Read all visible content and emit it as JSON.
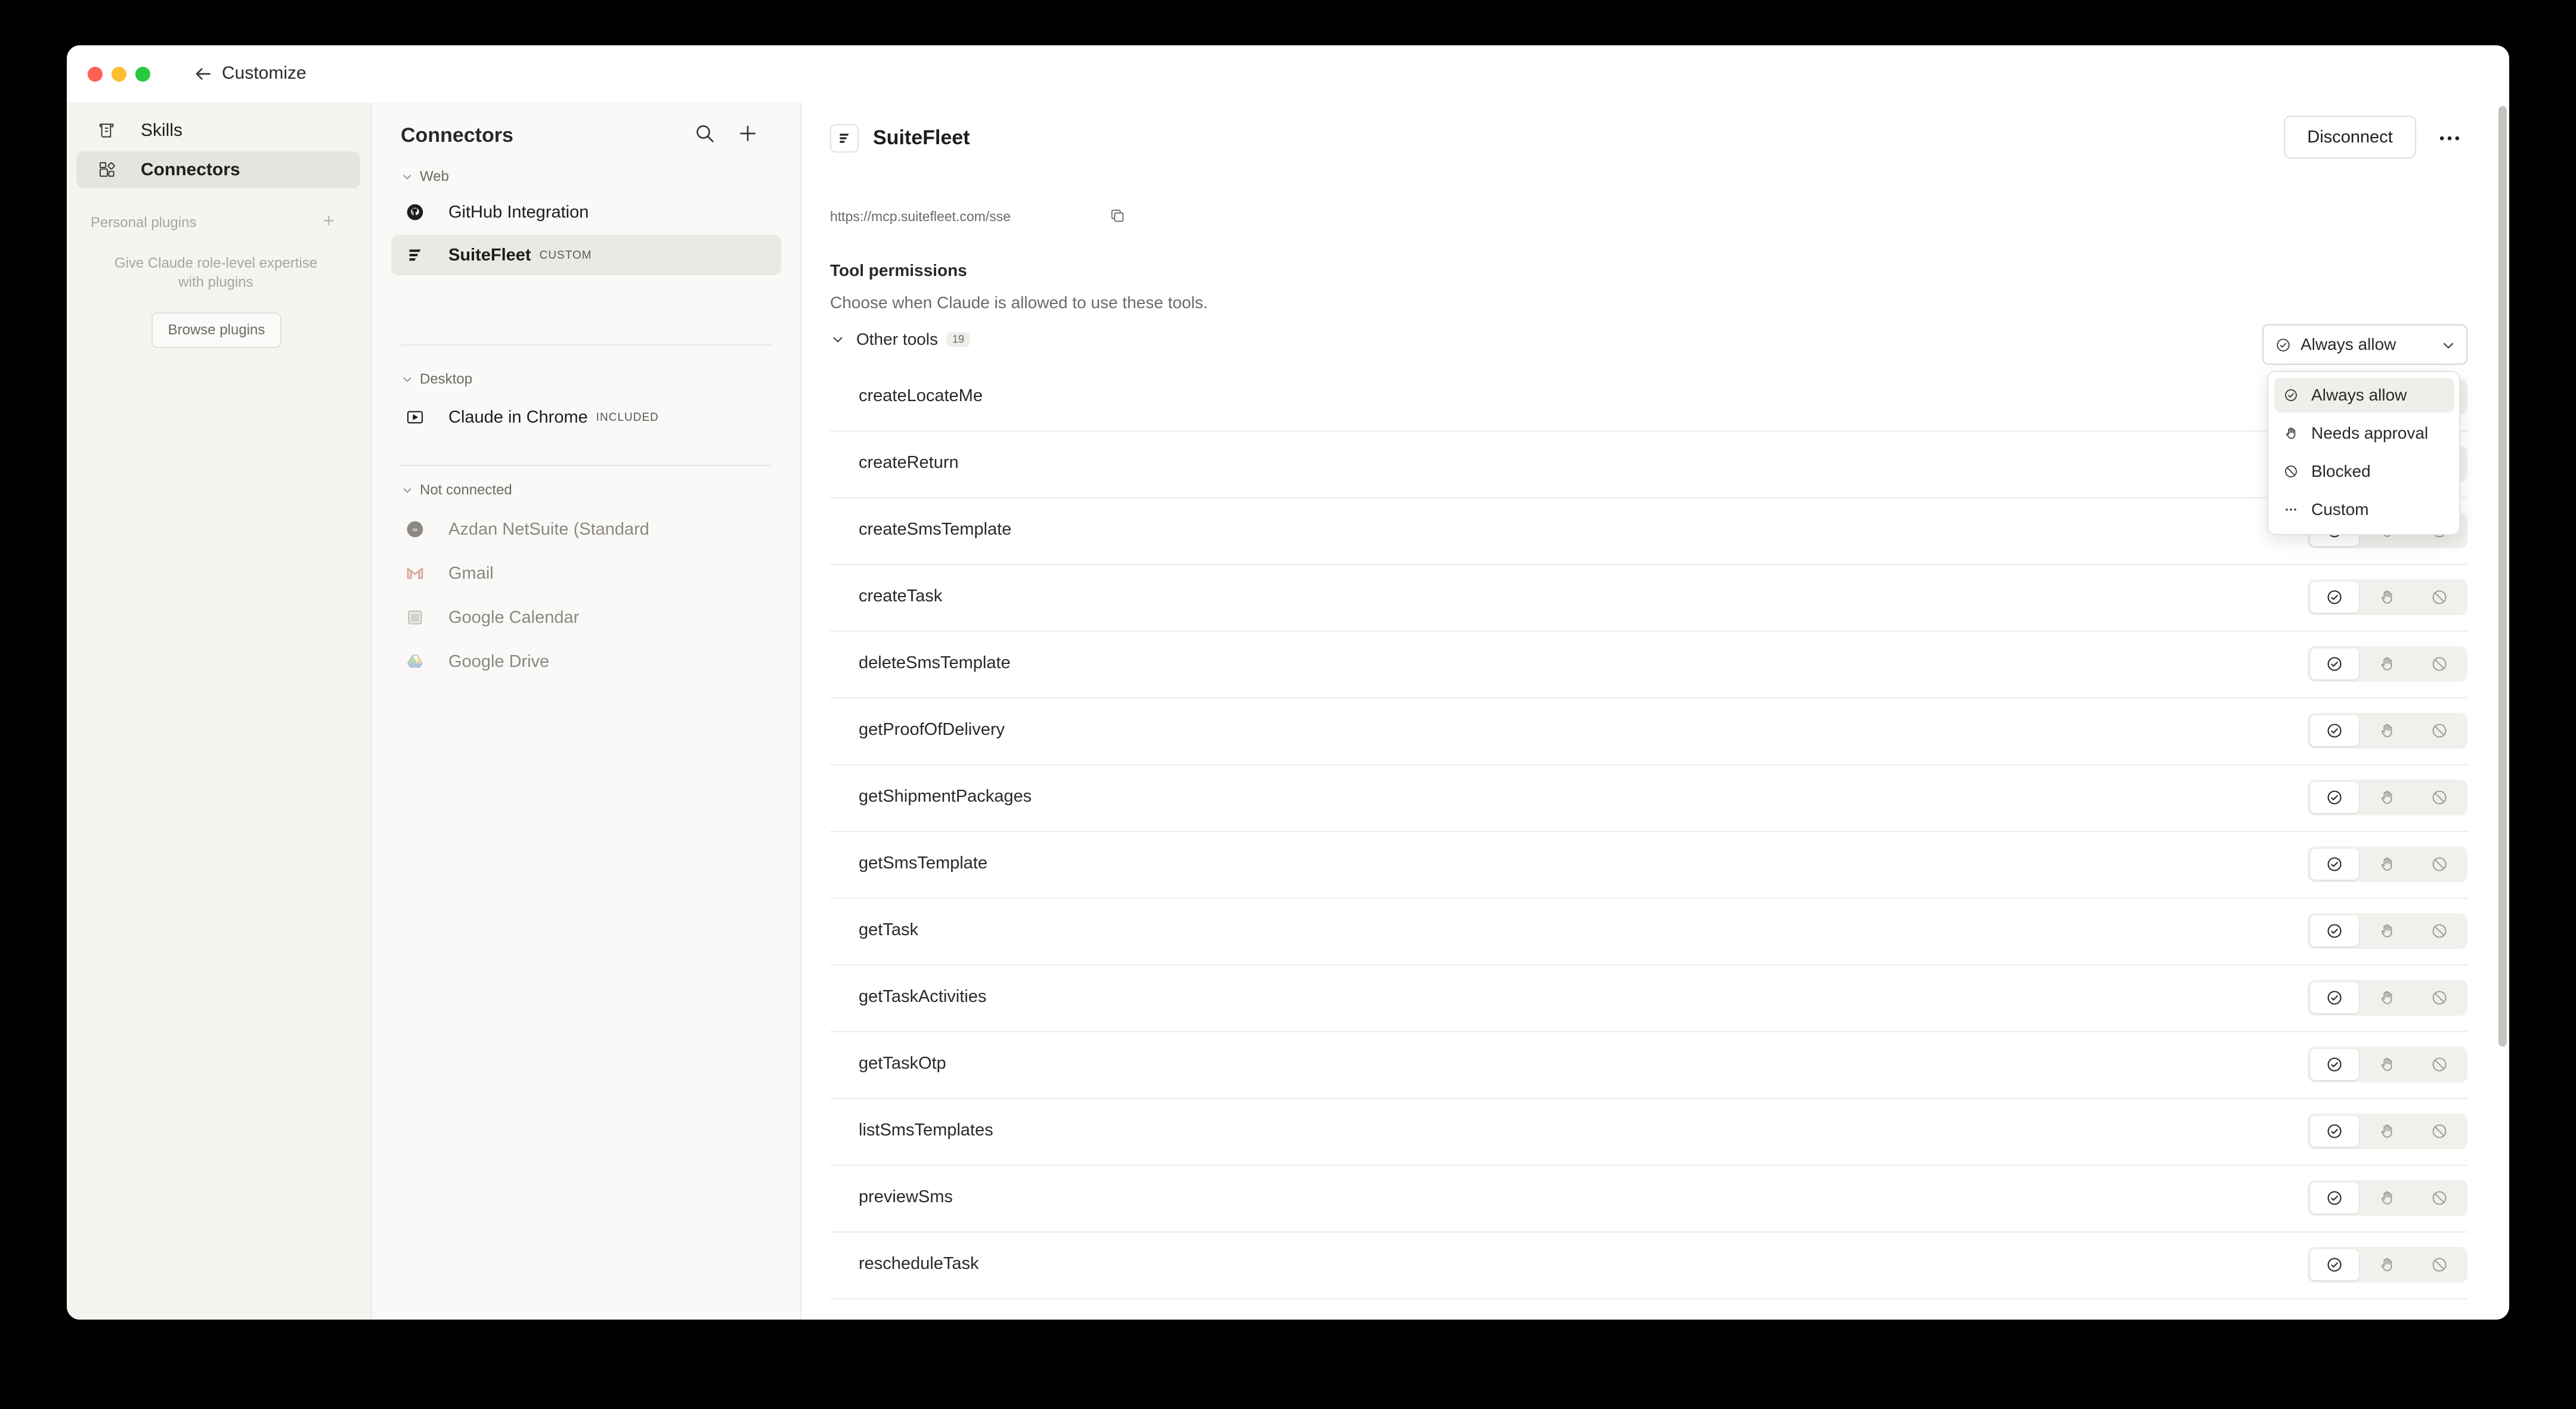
{
  "window": {
    "title": "Customize"
  },
  "sidebar": {
    "items": [
      {
        "label": "Skills",
        "icon": "skills-icon"
      },
      {
        "label": "Connectors",
        "icon": "connectors-icon",
        "active": true
      }
    ],
    "personal_plugins": {
      "heading": "Personal plugins",
      "description": "Give Claude role-level expertise with plugins",
      "browse_label": "Browse plugins"
    }
  },
  "connectors": {
    "title": "Connectors",
    "groups": {
      "web": "Web",
      "desktop": "Desktop",
      "not_connected": "Not connected"
    },
    "web_items": [
      {
        "label": "GitHub Integration",
        "icon": "github-icon"
      },
      {
        "label": "SuiteFleet",
        "badge": "CUSTOM",
        "icon": "suitefleet-icon",
        "active": true
      }
    ],
    "desktop_items": [
      {
        "label": "Claude in Chrome",
        "badge": "INCLUDED",
        "icon": "chrome-extension-icon"
      }
    ],
    "not_connected_items": [
      {
        "label": "Azdan NetSuite (Standard",
        "icon": "netsuite-icon"
      },
      {
        "label": "Gmail",
        "icon": "gmail-icon"
      },
      {
        "label": "Google Calendar",
        "icon": "google-calendar-icon"
      },
      {
        "label": "Google Drive",
        "icon": "google-drive-icon"
      }
    ]
  },
  "main": {
    "title": "SuiteFleet",
    "disconnect_label": "Disconnect",
    "url": "https://mcp.suitefleet.com/sse",
    "permissions_title": "Tool permissions",
    "permissions_subtitle": "Choose when Claude is allowed to use these tools.",
    "group_label": "Other tools",
    "group_count": "19",
    "select_value": "Always allow",
    "dropdown_options": [
      {
        "label": "Always allow",
        "icon": "check-circle-icon",
        "selected": true
      },
      {
        "label": "Needs approval",
        "icon": "hand-icon"
      },
      {
        "label": "Blocked",
        "icon": "blocked-icon"
      },
      {
        "label": "Custom",
        "icon": "ellipsis-icon"
      }
    ],
    "tools": [
      "createLocateMe",
      "createReturn",
      "createSmsTemplate",
      "createTask",
      "deleteSmsTemplate",
      "getProofOfDelivery",
      "getShipmentPackages",
      "getSmsTemplate",
      "getTask",
      "getTaskActivities",
      "getTaskOtp",
      "listSmsTemplates",
      "previewSms",
      "rescheduleTask"
    ]
  },
  "colors": {
    "window_bg": "#ffffff",
    "sidebar_bg": "#f5f4f1",
    "panel_bg": "#faf9f7",
    "text": "#1f1e1c",
    "muted": "#6d6a65"
  }
}
